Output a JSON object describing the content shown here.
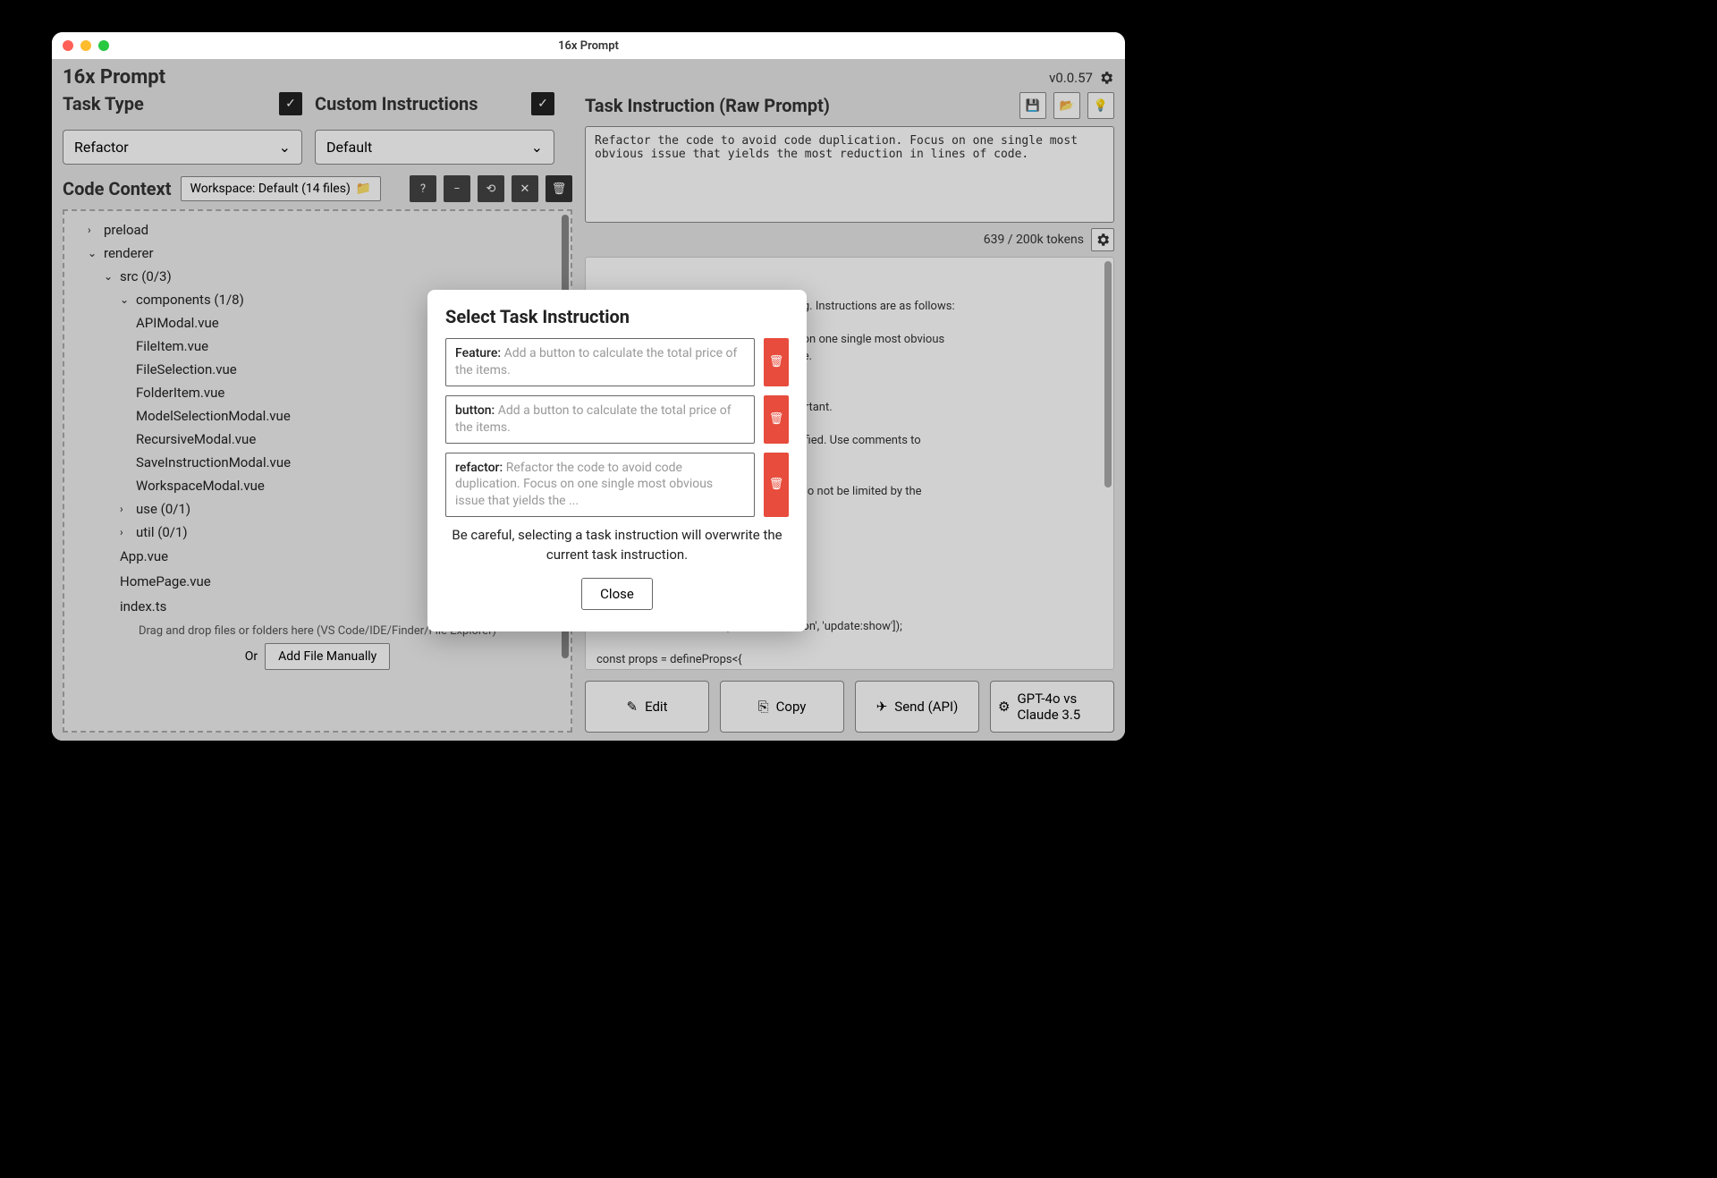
{
  "window": {
    "title": "16x Prompt"
  },
  "header": {
    "app_name": "16x Prompt",
    "version": "v0.0.57"
  },
  "task_type": {
    "label": "Task Type",
    "value": "Refactor",
    "checked": true
  },
  "custom_instructions": {
    "label": "Custom Instructions",
    "value": "Default",
    "checked": true
  },
  "code_context": {
    "label": "Code Context",
    "workspace_btn": "Workspace: Default (14 files)",
    "tree": {
      "preload": "preload",
      "renderer": "renderer",
      "src": "src (0/3)",
      "components": "components (1/8)",
      "files_components": [
        "APIModal.vue",
        "FileItem.vue",
        "FileSelection.vue",
        "FolderItem.vue",
        "ModelSelectionModal.vue",
        "RecursiveModal.vue",
        "SaveInstructionModal.vue",
        "WorkspaceModal.vue"
      ],
      "use": "use (0/1)",
      "util": "util (0/1)",
      "root_files": [
        "App.vue",
        "HomePage.vue",
        "index.ts"
      ]
    },
    "dnd_text": "Drag and drop files or folders here (VS Code/IDE/Finder/File Explorer)",
    "or_text": "Or",
    "add_manual": "Add File Manually"
  },
  "task_instruction": {
    "label": "Task Instruction (Raw Prompt)",
    "raw": "Refactor the code to avoid code duplication. Focus on one single most obvious issue that yields the most reduction in lines of code.",
    "token_text": "639 / 200k tokens",
    "preview": "                              refactoring. Instructions are as follows:\n\n                              ode duplication. Focus on one single most obvious\n                              eduction in lines of code.\n\n                              format:\n                              otions, unless it is important.\n                              nd empty lines.\n                              e that needs to be modified. Use comments to\n                              not modified.\n                              aste.\n                              s to achieve the result, do not be limited by the\n\n\n                              InstructionModal.vue\n\n                              tch} from 'vue';\n                              on} from '#preload';\n\nconst emit = defineEmits(['save-instruction', 'update:show']);\n\nconst props = defineProps<{\n  show: boolean;\n  content: string;\n}>();\n\nconst instructionName = ref<string>('');"
  },
  "bottom_actions": {
    "edit": "Edit",
    "copy": "Copy",
    "send": "Send (API)",
    "models": "GPT-4o vs Claude 3.5"
  },
  "modal": {
    "title": "Select Task Instruction",
    "instructions": [
      {
        "label": "Feature:",
        "text": "Add a button to calculate the total price of the items."
      },
      {
        "label": "button:",
        "text": "Add a button to calculate the total price of the items."
      },
      {
        "label": "refactor:",
        "text": "Refactor the code to avoid code duplication. Focus on one single most obvious issue that yields the ..."
      }
    ],
    "warning": "Be careful, selecting a task instruction will overwrite the current task instruction.",
    "close": "Close"
  }
}
